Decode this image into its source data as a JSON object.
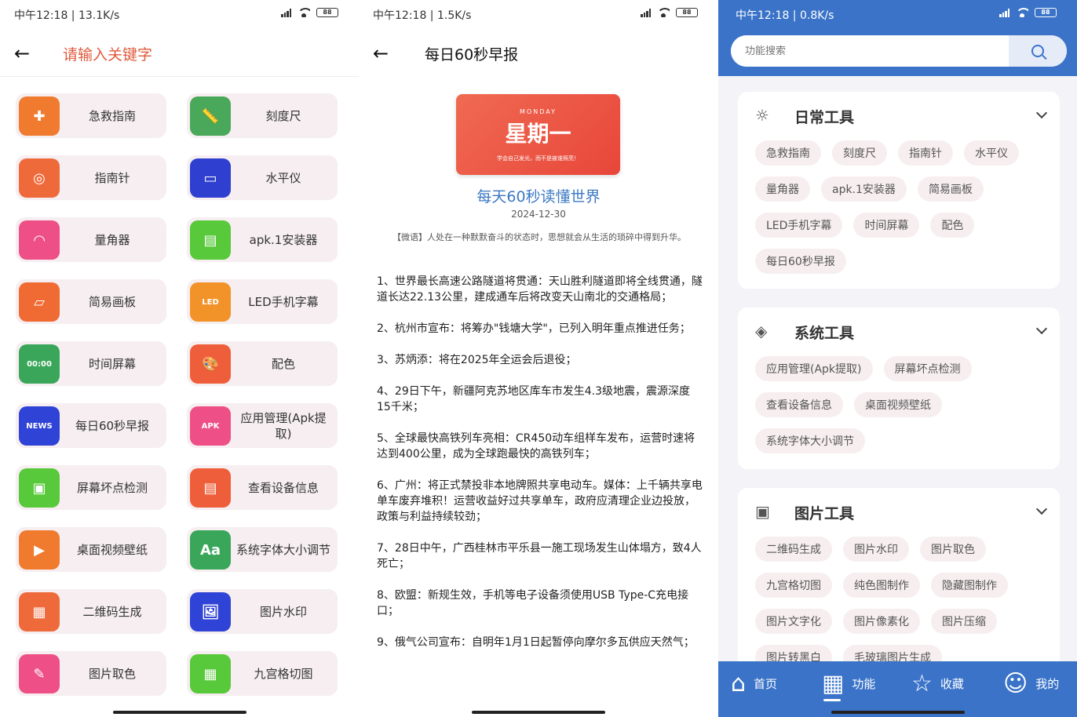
{
  "status_bars": [
    {
      "time": "中午12:18 | 13.1K/s",
      "battery": "88"
    },
    {
      "time": "中午12:18 | 1.5K/s",
      "battery": "88"
    },
    {
      "time": "中午12:18 | 0.8K/s",
      "battery": "88"
    }
  ],
  "search_page": {
    "placeholder": "请输入关键字",
    "tools": [
      {
        "label": "急救指南",
        "icon": "first-aid-icon",
        "color": "#f07a2e",
        "glyph": "✚"
      },
      {
        "label": "刻度尺",
        "icon": "ruler-icon",
        "color": "#4aa85a",
        "glyph": "📏"
      },
      {
        "label": "指南针",
        "icon": "compass-icon",
        "color": "#ef6a3b",
        "glyph": "◎"
      },
      {
        "label": "水平仪",
        "icon": "level-icon",
        "color": "#2f3fd0",
        "glyph": "▭"
      },
      {
        "label": "量角器",
        "icon": "protractor-icon",
        "color": "#ee4f86",
        "glyph": "◠"
      },
      {
        "label": "apk.1安装器",
        "icon": "apk-installer-icon",
        "color": "#58c93a",
        "glyph": "▤"
      },
      {
        "label": "简易画板",
        "icon": "drawing-board-icon",
        "color": "#f06a34",
        "glyph": "▱"
      },
      {
        "label": "LED手机字幕",
        "icon": "led-icon",
        "color": "#f2932a",
        "glyph": "LED"
      },
      {
        "label": "时间屏幕",
        "icon": "clock-screen-icon",
        "color": "#3aa65a",
        "glyph": "00:00"
      },
      {
        "label": "配色",
        "icon": "palette-icon",
        "color": "#ef5e3a",
        "glyph": "🎨"
      },
      {
        "label": "每日60秒早报",
        "icon": "news-icon",
        "color": "#2f43d6",
        "glyph": "NEWS"
      },
      {
        "label": "应用管理(Apk提取)",
        "icon": "apk-manager-icon",
        "color": "#ee4f86",
        "glyph": "APK"
      },
      {
        "label": "屏幕坏点检测",
        "icon": "screen-check-icon",
        "color": "#58c93a",
        "glyph": "▣"
      },
      {
        "label": "查看设备信息",
        "icon": "device-info-icon",
        "color": "#ef5e3a",
        "glyph": "▤"
      },
      {
        "label": "桌面视频壁纸",
        "icon": "video-wallpaper-icon",
        "color": "#f07a2e",
        "glyph": "▶"
      },
      {
        "label": "系统字体大小调节",
        "icon": "font-size-icon",
        "color": "#3aa65a",
        "glyph": "Aa"
      },
      {
        "label": "二维码生成",
        "icon": "qr-code-icon",
        "color": "#ef6a3b",
        "glyph": "▦"
      },
      {
        "label": "图片水印",
        "icon": "image-watermark-icon",
        "color": "#2f43d6",
        "glyph": "🖼"
      },
      {
        "label": "图片取色",
        "icon": "color-picker-icon",
        "color": "#ee4f86",
        "glyph": "✎"
      },
      {
        "label": "九宫格切图",
        "icon": "grid-cut-icon",
        "color": "#58c93a",
        "glyph": "▦"
      }
    ]
  },
  "news_page": {
    "title": "每日60秒早报",
    "banner": {
      "day_en": "MONDAY",
      "day": "星期一",
      "motto": "学会自己发光，而不是被谁照亮！"
    },
    "headline": "每天60秒读懂世界",
    "date": "2024-12-30",
    "quote": "【微语】人处在一种默默奋斗的状态时，思想就会从生活的琐碎中得到升华。",
    "items": [
      "1、世界最长高速公路隧道将贯通：天山胜利隧道即将全线贯通，隧道长达22.13公里，建成通车后将改变天山南北的交通格局；",
      "2、杭州市宣布：将筹办\"钱塘大学\"，已列入明年重点推进任务；",
      "3、苏炳添：将在2025年全运会后退役；",
      "4、29日下午，新疆阿克苏地区库车市发生4.3级地震，震源深度15千米；",
      "5、全球最快高铁列车亮相：CR450动车组样车发布，运营时速将达到400公里，成为全球跑最快的高铁列车；",
      "6、广州：将正式禁投非本地牌照共享电动车。媒体：上千辆共享电单车废弃堆积！运营收益好过共享单车，政府应清理企业边投放，政策与利益持续较劲；",
      "7、28日中午，广西桂林市平乐县一施工现场发生山体塌方，致4人死亡；",
      "8、欧盟：新规生效，手机等电子设备须使用USB Type-C充电接口；",
      "9、俄气公司宣布：自明年1月1日起暂停向摩尔多瓦供应天然气；"
    ]
  },
  "functions_page": {
    "search_placeholder": "功能搜索",
    "sections": [
      {
        "title": "日常工具",
        "icon": "sun-icon",
        "glyph": "☼",
        "chips": [
          "急救指南",
          "刻度尺",
          "指南针",
          "水平仪",
          "量角器",
          "apk.1安装器",
          "简易画板",
          "LED手机字幕",
          "时间屏幕",
          "配色",
          "每日60秒早报"
        ]
      },
      {
        "title": "系统工具",
        "icon": "shield-icon",
        "glyph": "◈",
        "chips": [
          "应用管理(Apk提取)",
          "屏幕坏点检测",
          "查看设备信息",
          "桌面视频壁纸",
          "系统字体大小调节"
        ]
      },
      {
        "title": "图片工具",
        "icon": "image-icon",
        "glyph": "▣",
        "chips": [
          "二维码生成",
          "图片水印",
          "图片取色",
          "九宫格切图",
          "纯色图制作",
          "隐藏图制作",
          "图片文字化",
          "图片像素化",
          "图片压缩",
          "图片转黑白",
          "毛玻璃图片生成"
        ]
      }
    ],
    "bottom_nav": [
      {
        "label": "首页",
        "icon": "home-icon",
        "glyph": "⌂"
      },
      {
        "label": "功能",
        "icon": "apps-icon",
        "glyph": "▦"
      },
      {
        "label": "收藏",
        "icon": "star-icon",
        "glyph": "☆"
      },
      {
        "label": "我的",
        "icon": "profile-icon",
        "glyph": "☺"
      }
    ],
    "brand_color": "#3a73c8"
  }
}
